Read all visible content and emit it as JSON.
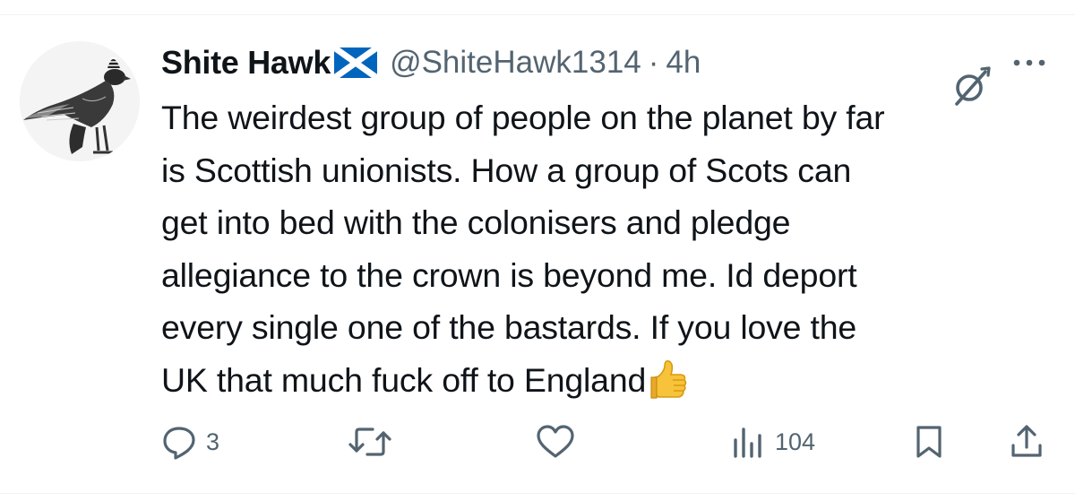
{
  "author": {
    "display_name": "Shite Hawk",
    "flag": "scotland-flag-icon",
    "handle": "@ShiteHawk1314",
    "separator": "·",
    "time": "4h"
  },
  "tweet": {
    "lines": [
      "The weirdest group of people on the planet by far",
      "is Scottish unionists. How a group of Scots can",
      "get into bed with the colonisers and pledge",
      "allegiance to the crown is beyond me. Id deport",
      "every single one of the bastards. If you love the",
      "UK that much fuck off to England"
    ],
    "trailing_emoji": "thumbs-up-emoji"
  },
  "actions": {
    "reply_count": "3",
    "retweet_count": "",
    "like_count": "",
    "views_count": "104"
  },
  "colors": {
    "text": "#0f1419",
    "muted": "#536471",
    "divider": "#eff3f4",
    "flag_blue": "#0065bd"
  }
}
